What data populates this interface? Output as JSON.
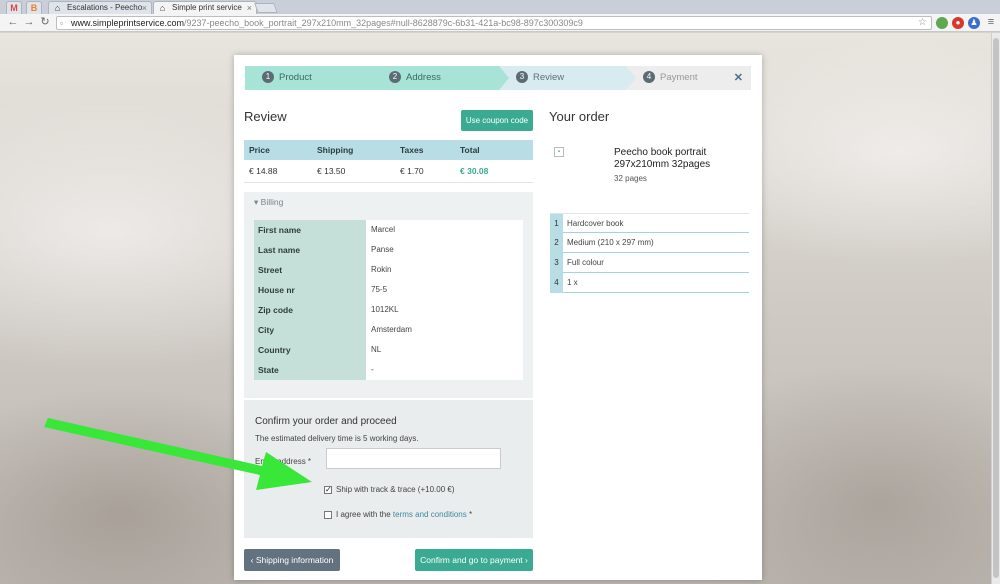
{
  "browser": {
    "tabs": [
      {
        "icon": "gmail-icon",
        "label": ""
      },
      {
        "icon": "blogger-icon",
        "label": ""
      },
      {
        "icon": "house-icon",
        "label": "Escalations - Peecho"
      },
      {
        "icon": "house-icon",
        "label": "Simple print service"
      }
    ],
    "url_host": "www.simpleprintservice.com",
    "url_path": "/9237-peecho_book_portrait_297x210mm_32pages#null-8628879c-6b31-421a-bc98-897c300309c9"
  },
  "steps": [
    {
      "num": "1",
      "label": "Product",
      "state": "done"
    },
    {
      "num": "2",
      "label": "Address",
      "state": "done"
    },
    {
      "num": "3",
      "label": "Review",
      "state": "active"
    },
    {
      "num": "4",
      "label": "Payment",
      "state": "todo"
    }
  ],
  "review": {
    "title": "Review",
    "coupon_button": "Use coupon code",
    "totals": {
      "headers": [
        "Price",
        "Shipping",
        "Taxes",
        "Total"
      ],
      "values": [
        "€ 14.88",
        "€ 13.50",
        "€ 1.70",
        "€ 30.08"
      ]
    },
    "billing": {
      "heading": "Billing",
      "rows": [
        {
          "label": "First name",
          "value": "Marcel"
        },
        {
          "label": "Last name",
          "value": "Panse"
        },
        {
          "label": "Street",
          "value": "Rokin"
        },
        {
          "label": "House nr",
          "value": "75-5"
        },
        {
          "label": "Zip code",
          "value": "1012KL"
        },
        {
          "label": "City",
          "value": "Amsterdam"
        },
        {
          "label": "Country",
          "value": "NL"
        },
        {
          "label": "State",
          "value": "-"
        }
      ]
    },
    "confirm": {
      "title": "Confirm your order and proceed",
      "subtitle": "The estimated delivery time is 5 working days.",
      "email_label": "Email address *",
      "email_value": "",
      "ship_track_label": "Ship with track & trace (+10.00 €)",
      "ship_track_checked": true,
      "agree_prefix": "I agree with the ",
      "agree_link": "terms and conditions",
      "agree_suffix": " *",
      "agree_checked": false
    },
    "back_button": "Shipping information",
    "next_button": "Confirm and go to payment"
  },
  "order": {
    "title": "Your order",
    "product_name": "Peecho book portrait 297x210mm 32pages",
    "product_pages": "32 pages",
    "specs": [
      {
        "num": "1",
        "label": "Hardcover book"
      },
      {
        "num": "2",
        "label": "Medium (210 x 297 mm)"
      },
      {
        "num": "3",
        "label": "Full colour"
      },
      {
        "num": "4",
        "label": "1 x"
      }
    ]
  },
  "colors": {
    "accent": "#3aaa93",
    "arrow": "#39e739"
  }
}
